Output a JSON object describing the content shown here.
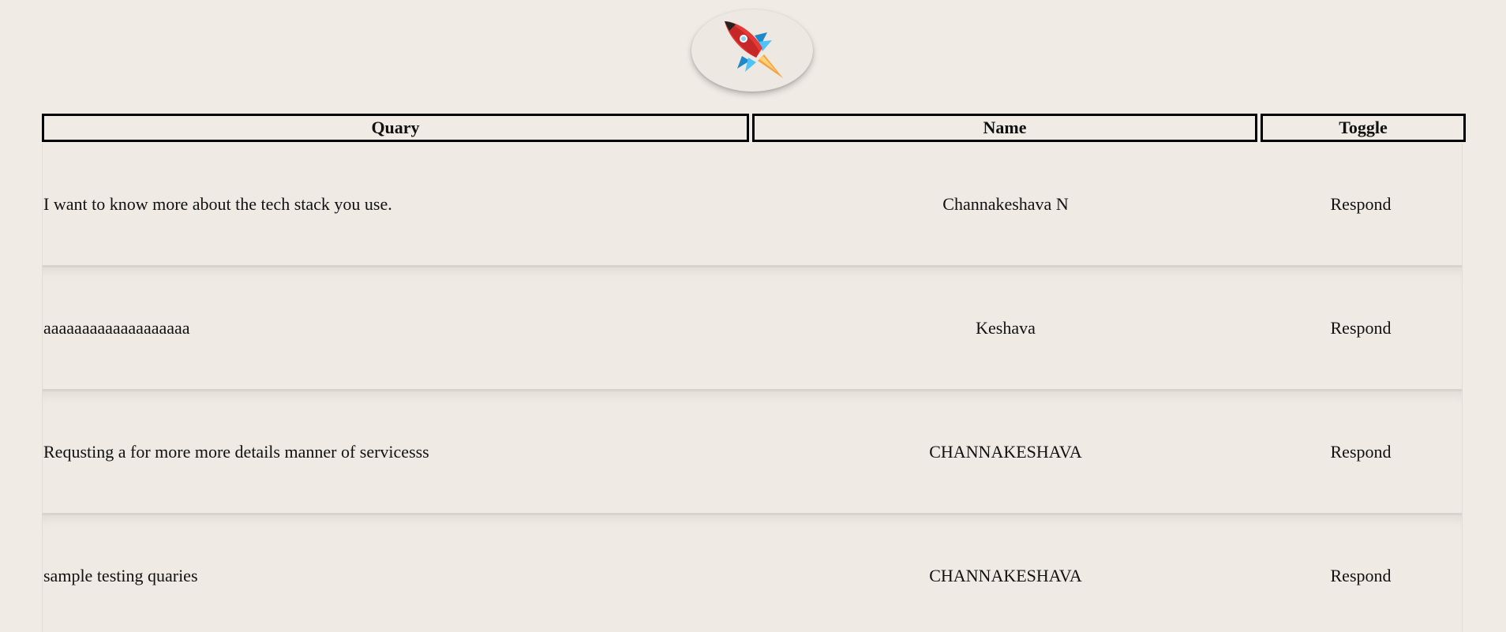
{
  "table": {
    "headers": {
      "quary": "Quary",
      "name": "Name",
      "toggle": "Toggle"
    },
    "rows": [
      {
        "quary": "I want to know more about the tech stack you use.",
        "name": "Channakeshava N",
        "toggle": "Respond"
      },
      {
        "quary": "aaaaaaaaaaaaaaaaaaa",
        "name": "Keshava",
        "toggle": "Respond"
      },
      {
        "quary": "Requsting a for more more details manner of servicesss",
        "name": "CHANNAKESHAVA",
        "toggle": "Respond"
      },
      {
        "quary": "sample testing quaries",
        "name": "CHANNAKESHAVA",
        "toggle": "Respond"
      }
    ]
  },
  "logo": {
    "icon": "rocket-icon"
  },
  "colors": {
    "background": "#f0ebe5",
    "header_border": "#000000",
    "row_divider": "#d8d3cd",
    "rocket_body": "#e53935",
    "rocket_fin": "#29b6f6",
    "rocket_flame": "#f4a340"
  }
}
